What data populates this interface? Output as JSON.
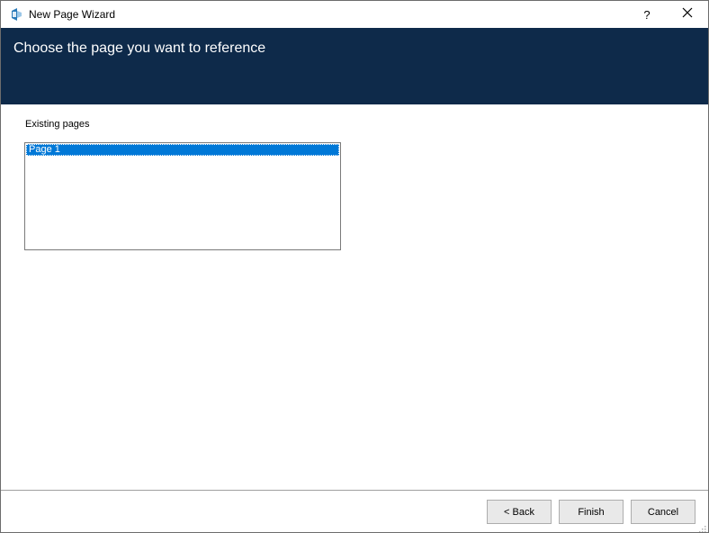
{
  "window": {
    "title": "New Page Wizard",
    "help_label": "?",
    "app_icon": "onenote-icon",
    "close_icon": "close-icon"
  },
  "banner": {
    "title": "Choose the page you want to reference",
    "color": "#0e2a4a"
  },
  "content": {
    "existing_label": "Existing pages",
    "pages": [
      {
        "label": "Page 1",
        "selected": true
      }
    ],
    "selection_color": "#0078d7"
  },
  "footer": {
    "back_label": "< Back",
    "finish_label": "Finish",
    "cancel_label": "Cancel"
  }
}
